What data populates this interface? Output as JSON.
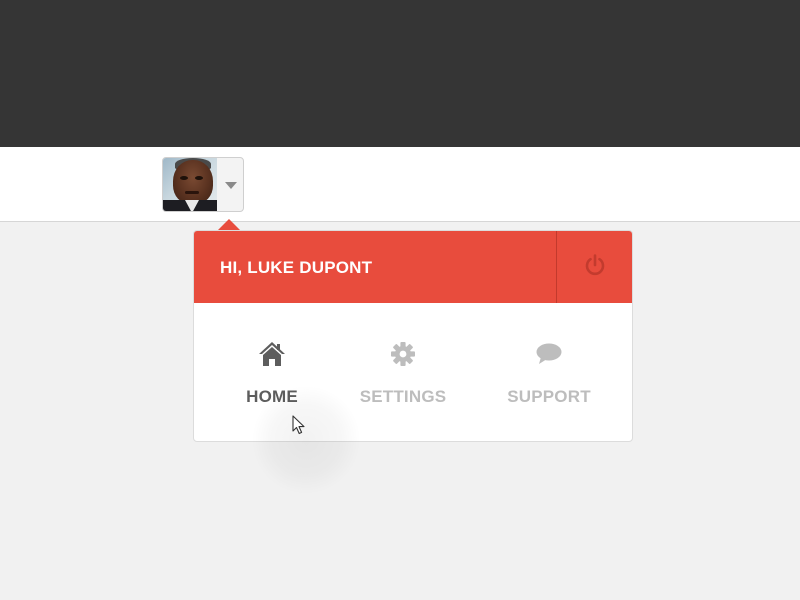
{
  "header": {
    "user_menu": {
      "avatar_alt": "User avatar",
      "caret_icon": "chevron-down-icon"
    }
  },
  "dropdown": {
    "greeting": "HI, LUKE DUPONT",
    "power_icon": "power-icon",
    "accent_color": "#e84c3d",
    "items": [
      {
        "label": "HOME",
        "icon": "home-icon",
        "active": true
      },
      {
        "label": "SETTINGS",
        "icon": "gear-icon",
        "active": false
      },
      {
        "label": "SUPPORT",
        "icon": "speech-bubble-icon",
        "active": false
      }
    ]
  },
  "colors": {
    "topbar": "#353535",
    "navbar": "#ffffff",
    "page_background": "#f1f1f1",
    "active_label": "#5d5d5d",
    "inactive_label": "#bdbdbd"
  }
}
